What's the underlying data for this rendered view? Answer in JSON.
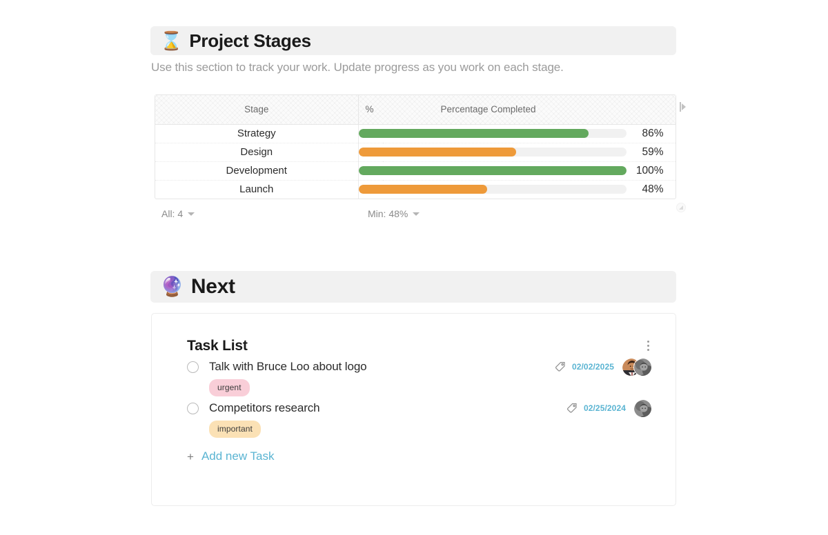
{
  "stages_section": {
    "emoji": "⌛",
    "emoji_name": "hourglass-icon",
    "title": "Project Stages",
    "description": "Use this section to track your work. Update progress as you work on each stage.",
    "table": {
      "columns": [
        "Stage",
        "%",
        "Percentage Completed"
      ],
      "rows": [
        {
          "stage": "Strategy",
          "percent": 86,
          "value_label": "86%",
          "color": "#63a95e"
        },
        {
          "stage": "Design",
          "percent": 59,
          "value_label": "59%",
          "color": "#ee9a3a"
        },
        {
          "stage": "Development",
          "percent": 100,
          "value_label": "100%",
          "color": "#63a95e"
        },
        {
          "stage": "Launch",
          "percent": 48,
          "value_label": "48%",
          "color": "#ee9a3a"
        }
      ]
    },
    "footer": {
      "all_label": "All: 4",
      "min_label": "Min: 48%"
    }
  },
  "next_section": {
    "emoji": "🔮",
    "emoji_name": "crystal-ball-icon",
    "title": "Next",
    "card": {
      "title": "Task List",
      "add_task_label": "Add new Task",
      "add_task_plus": "+",
      "tasks": [
        {
          "text": "Talk with Bruce Loo about logo",
          "date": "02/02/2025",
          "tag": {
            "label": "urgent",
            "color": "#f9ced8"
          },
          "avatar_count": 2
        },
        {
          "text": "Competitors research",
          "date": "02/25/2024",
          "tag": {
            "label": "important",
            "color": "#fbe1b5"
          },
          "avatar_count": 1
        }
      ]
    }
  },
  "chart_data": {
    "type": "bar",
    "title": "Percentage Completed",
    "categories": [
      "Strategy",
      "Design",
      "Development",
      "Launch"
    ],
    "values": [
      86,
      59,
      100,
      48
    ],
    "xlabel": "Stage",
    "ylabel": "Percentage Completed",
    "ylim": [
      0,
      100
    ],
    "grid": false,
    "legend": "none",
    "colors": [
      "#63a95e",
      "#ee9a3a",
      "#63a95e",
      "#ee9a3a"
    ]
  },
  "theme": {
    "header_bg": "#f1f1f1",
    "green": "#63a95e",
    "orange": "#ee9a3a",
    "link_blue": "#5ab4d2",
    "track_gray": "#f1f1f1"
  }
}
